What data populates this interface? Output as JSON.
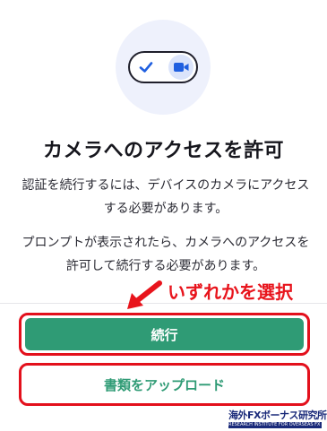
{
  "hero": {
    "icons": [
      "check-icon",
      "camera-icon"
    ]
  },
  "title": "カメラへのアクセスを許可",
  "paragraphs": {
    "p1": "認証を続行するには、デバイスのカメラにアクセスする必要があります。",
    "p2": "プロンプトが表示されたら、カメラへのアクセスを許可して続行する必要があります。"
  },
  "annotation": {
    "text": "いずれかを選択",
    "color": "#e8141c"
  },
  "buttons": {
    "continue_label": "続行",
    "upload_label": "書類をアップロード"
  },
  "watermark": {
    "main": "海外FXボーナス研究所",
    "sub": "RESEARCH INSTITUTE FOR OVERSEAS FX BONUS"
  },
  "colors": {
    "accent": "#2f9b75",
    "highlight": "#e3101c"
  }
}
